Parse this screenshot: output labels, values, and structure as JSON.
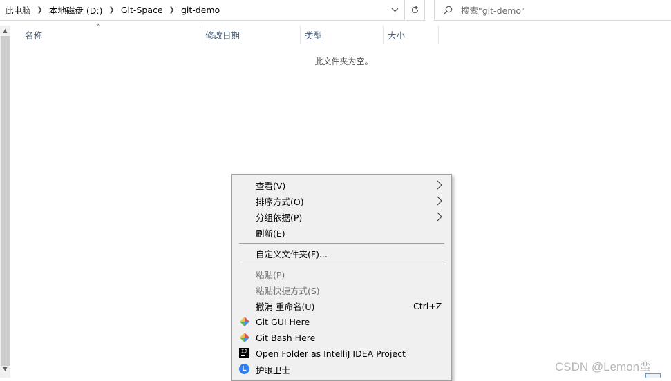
{
  "address": {
    "crumbs": [
      "此电脑",
      "本地磁盘 (D:)",
      "Git-Space",
      "git-demo"
    ]
  },
  "search": {
    "placeholder": "搜索\"git-demo\""
  },
  "columns": {
    "name": "名称",
    "modified": "修改日期",
    "type": "类型",
    "size": "大小"
  },
  "empty_message": "此文件夹为空。",
  "context_menu": {
    "items": [
      {
        "label": "查看(V)",
        "submenu": true
      },
      {
        "label": "排序方式(O)",
        "submenu": true
      },
      {
        "label": "分组依据(P)",
        "submenu": true
      },
      {
        "label": "刷新(E)"
      },
      {
        "label": "自定义文件夹(F)..."
      },
      {
        "label": "粘贴(P)",
        "disabled": true
      },
      {
        "label": "粘贴快捷方式(S)",
        "disabled": true
      },
      {
        "label": "撤消 重命名(U)",
        "shortcut": "Ctrl+Z"
      },
      {
        "label": "Git GUI Here",
        "icon": "git-diamond-icon"
      },
      {
        "label": "Git Bash Here",
        "icon": "git-diamond-icon"
      },
      {
        "label": "Open Folder as IntelliJ IDEA Project",
        "icon": "intellij-idea-icon"
      },
      {
        "label": "护眼卫士",
        "icon": "eye-guard-icon"
      }
    ]
  },
  "watermark": "CSDN @Lemon蛮",
  "colors": {
    "header_text": "#4c607a",
    "menu_bg": "#f0f0f0",
    "disabled_text": "#6d6d6d"
  }
}
